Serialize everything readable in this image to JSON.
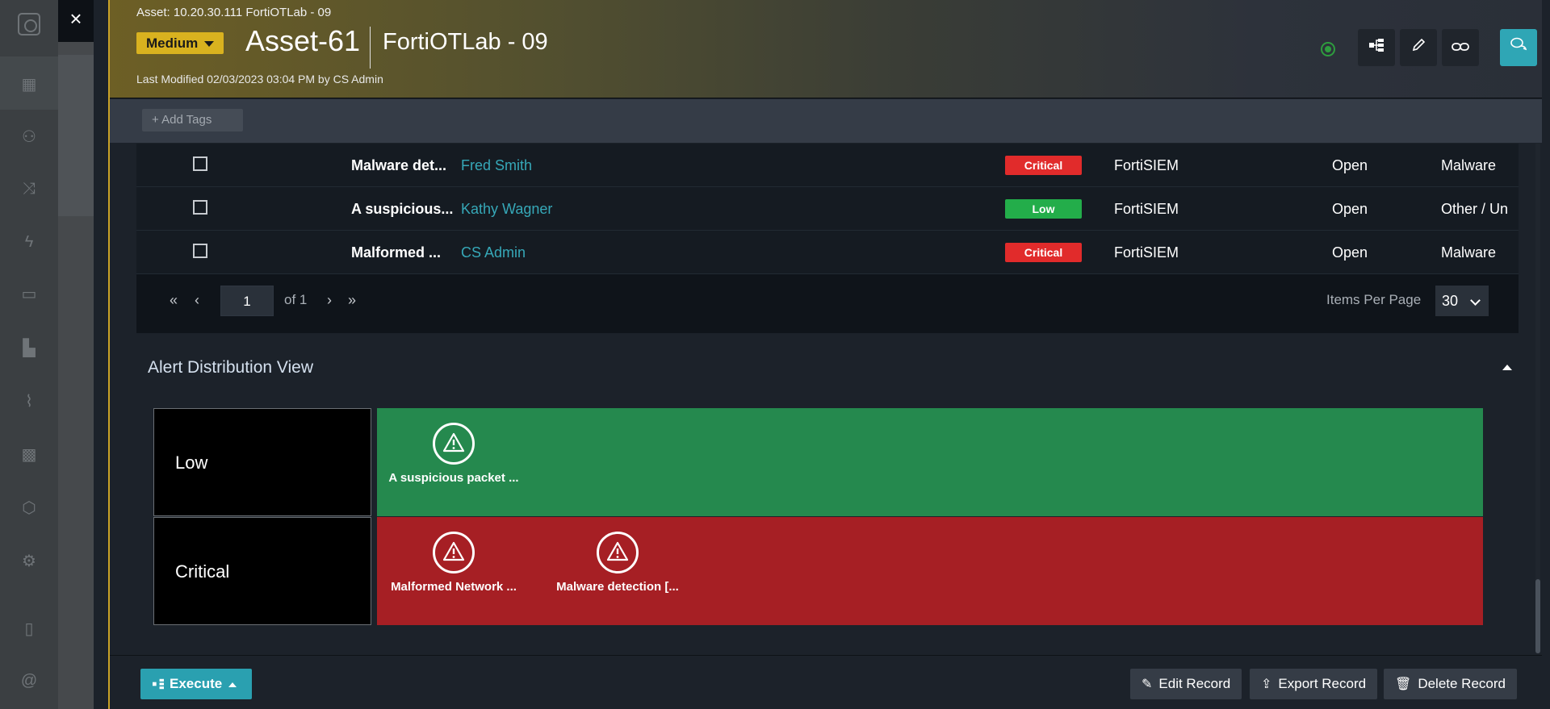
{
  "header": {
    "asset_path": "Asset: 10.20.30.111 FortiOTLab - 09",
    "severity": "Medium",
    "asset_name": "Asset-61",
    "lab_name": "FortiOTLab - 09",
    "last_modified": "Last Modified 02/03/2023 03:04 PM by CS Admin",
    "close_icon": "×"
  },
  "tags": {
    "add_label": "+ Add Tags"
  },
  "alerts": {
    "rows": [
      {
        "title": "Malware det...",
        "user": "Fred Smith",
        "severity": "Critical",
        "severity_color": "#e12b2b",
        "source": "FortiSIEM",
        "status": "Open",
        "type": "Malware"
      },
      {
        "title": "A suspicious...",
        "user": "Kathy Wagner",
        "severity": "Low",
        "severity_color": "#23ad4a",
        "source": "FortiSIEM",
        "status": "Open",
        "type": "Other / Un"
      },
      {
        "title": "Malformed ...",
        "user": "CS Admin",
        "severity": "Critical",
        "severity_color": "#e12b2b",
        "source": "FortiSIEM",
        "status": "Open",
        "type": "Malware"
      }
    ],
    "pager": {
      "first": "«",
      "prev": "‹",
      "page": "1",
      "of": "of 1",
      "next": "›",
      "last": "»",
      "items_per_page_label": "Items Per Page",
      "items_per_page": "30"
    }
  },
  "distribution": {
    "title": "Alert Distribution View",
    "lanes": [
      {
        "label": "Low",
        "color": "#25894e",
        "items": [
          "A suspicious packet ..."
        ]
      },
      {
        "label": "Critical",
        "color": "#a61f24",
        "items": [
          "Malformed Network ...",
          "Malware detection [..."
        ]
      }
    ]
  },
  "footer": {
    "execute": "Execute",
    "edit": "Edit Record",
    "export": "Export Record",
    "delete": "Delete Record"
  },
  "colors": {
    "accent": "#2fa6b5",
    "severity_medium": "#d9b21f",
    "link": "#36a8b8"
  },
  "icons": {
    "header_buttons": [
      "live-status-icon",
      "playbook-icon",
      "edit-icon",
      "link-icon",
      "comments-icon"
    ],
    "nav": [
      "dashboard-icon",
      "incidents-icon",
      "shuffle-icon",
      "bolt-icon",
      "briefcase-icon",
      "factory-icon",
      "chart-icon",
      "widgets-icon",
      "shield-icon",
      "settings-icon",
      "trash-icon",
      "at-icon"
    ]
  }
}
